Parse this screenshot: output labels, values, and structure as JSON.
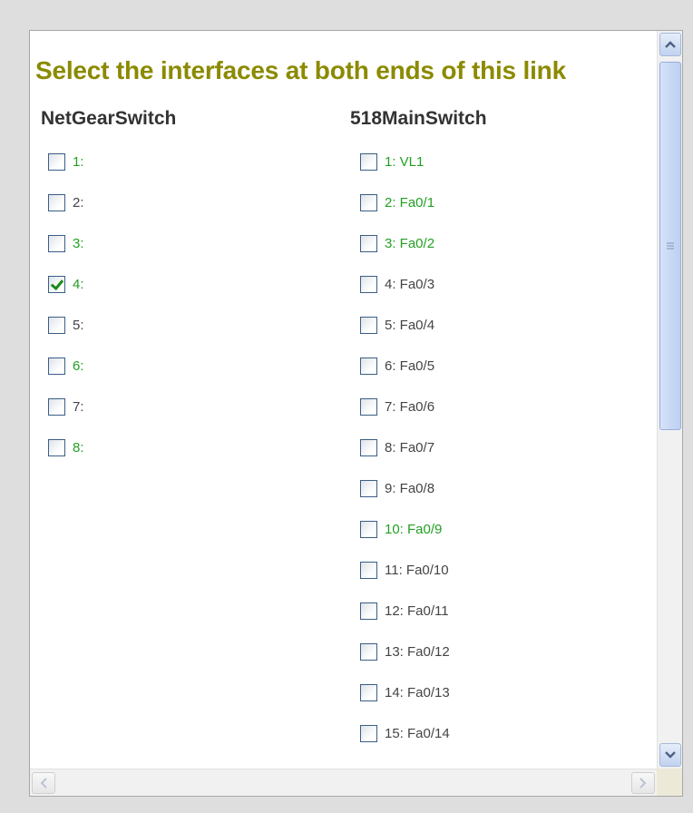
{
  "heading": "Select the interfaces at both ends of this link",
  "left_column": {
    "title": "NetGearSwitch",
    "items": [
      {
        "label": "1:",
        "color": "green",
        "checked": false
      },
      {
        "label": "2:",
        "color": "gray",
        "checked": false
      },
      {
        "label": "3:",
        "color": "green",
        "checked": false
      },
      {
        "label": "4:",
        "color": "green",
        "checked": true
      },
      {
        "label": "5:",
        "color": "gray",
        "checked": false
      },
      {
        "label": "6:",
        "color": "green",
        "checked": false
      },
      {
        "label": "7:",
        "color": "gray",
        "checked": false
      },
      {
        "label": "8:",
        "color": "green",
        "checked": false
      }
    ]
  },
  "right_column": {
    "title": "518MainSwitch",
    "items": [
      {
        "label": "1: VL1",
        "color": "green",
        "checked": false
      },
      {
        "label": "2: Fa0/1",
        "color": "green",
        "checked": false
      },
      {
        "label": "3: Fa0/2",
        "color": "green",
        "checked": false
      },
      {
        "label": "4: Fa0/3",
        "color": "gray",
        "checked": false
      },
      {
        "label": "5: Fa0/4",
        "color": "gray",
        "checked": false
      },
      {
        "label": "6: Fa0/5",
        "color": "gray",
        "checked": false
      },
      {
        "label": "7: Fa0/6",
        "color": "gray",
        "checked": false
      },
      {
        "label": "8: Fa0/7",
        "color": "gray",
        "checked": false
      },
      {
        "label": "9: Fa0/8",
        "color": "gray",
        "checked": false
      },
      {
        "label": "10: Fa0/9",
        "color": "green",
        "checked": false
      },
      {
        "label": "11: Fa0/10",
        "color": "gray",
        "checked": false
      },
      {
        "label": "12: Fa0/11",
        "color": "gray",
        "checked": false
      },
      {
        "label": "13: Fa0/12",
        "color": "gray",
        "checked": false
      },
      {
        "label": "14: Fa0/13",
        "color": "gray",
        "checked": false
      },
      {
        "label": "15: Fa0/14",
        "color": "gray",
        "checked": false
      }
    ]
  },
  "colors": {
    "heading": "#8b8a00",
    "active_label": "#22a022",
    "inactive_label": "#444444"
  },
  "scrollbar": {
    "up_icon": "arrow-up-icon",
    "down_icon": "arrow-down-icon",
    "left_icon": "arrow-left-icon",
    "right_icon": "arrow-right-icon"
  }
}
